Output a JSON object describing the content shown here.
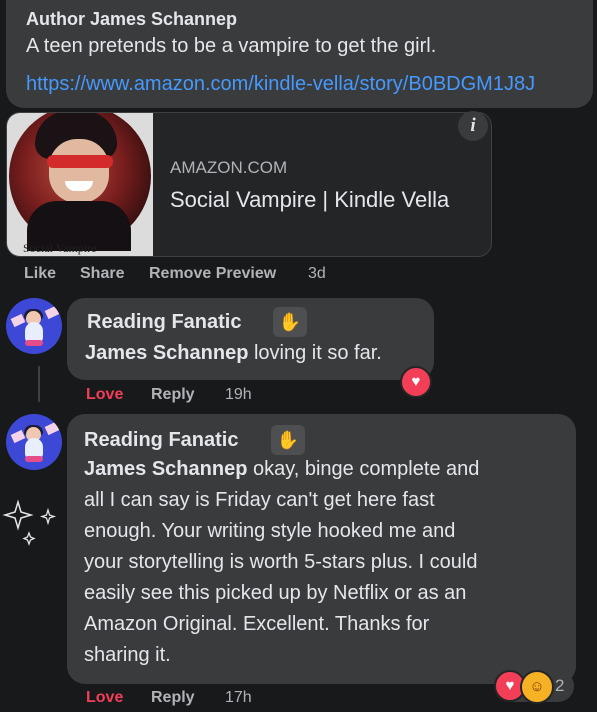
{
  "post": {
    "author": "Author James Schannep",
    "text": "A teen pretends to be a vampire to get the girl.",
    "link": "https://www.amazon.com/kindle-vella/story/B0BDGM1J8J"
  },
  "preview": {
    "domain": "AMAZON.COM",
    "title": "Social Vampire | Kindle Vella",
    "thumb_label": "Social Vampire",
    "info_glyph": "i"
  },
  "post_actions": {
    "like": "Like",
    "share": "Share",
    "remove_preview": "Remove Preview",
    "time": "3d"
  },
  "comments": [
    {
      "author": "Reading Fanatic",
      "badge_icon": "fan-badge-icon",
      "mention": "James Schannep",
      "text_lines": [
        "loving it so far."
      ],
      "actions": {
        "love": "Love",
        "reply": "Reply",
        "time": "19h"
      },
      "reaction_icon": "heart-icon"
    },
    {
      "author": "Reading Fanatic",
      "badge_icon": "fan-badge-icon",
      "mention": "James Schannep",
      "text_lines": [
        "okay, binge complete and",
        "all I can say is Friday can't get here fast",
        "enough. Your writing style hooked me and",
        "your storytelling is worth 5-stars plus. I could",
        "easily see this picked up by Netflix or as an",
        "Amazon Original. Excellent. Thanks for",
        "sharing it."
      ],
      "actions": {
        "love": "Love",
        "reply": "Reply",
        "time": "17h"
      },
      "reaction_icons": [
        "heart-icon",
        "care-icon"
      ],
      "reaction_count": "2"
    }
  ],
  "colors": {
    "bg": "#18191a",
    "bubble": "#3a3b3c",
    "link": "#4599ff",
    "love": "#f33e58",
    "muted": "#b0b3b8"
  }
}
